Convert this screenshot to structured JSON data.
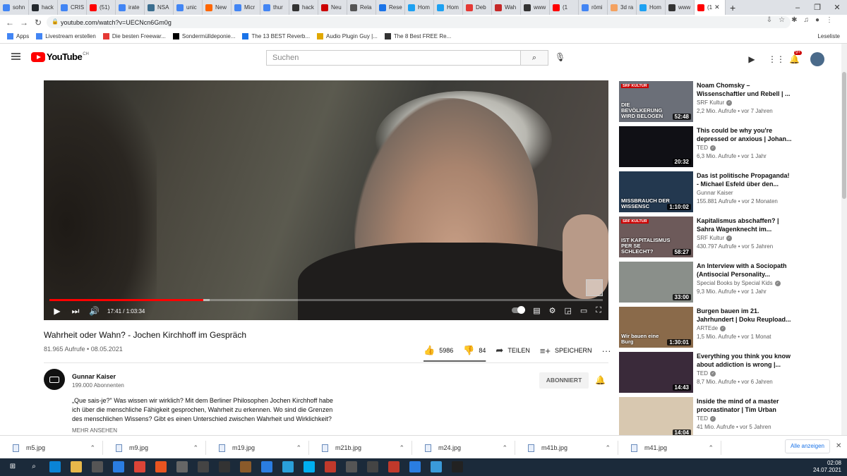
{
  "browser": {
    "tabs": [
      {
        "label": "sohn",
        "color": "#4285f4"
      },
      {
        "label": "hack",
        "color": "#24292e"
      },
      {
        "label": "CRIS",
        "color": "#4285f4"
      },
      {
        "label": "(51)",
        "color": "#ff0000"
      },
      {
        "label": "irate",
        "color": "#4285f4"
      },
      {
        "label": "NSA",
        "color": "#3b6e8f"
      },
      {
        "label": "unic",
        "color": "#4285f4"
      },
      {
        "label": "New",
        "color": "#ff6600"
      },
      {
        "label": "Micr",
        "color": "#4285f4"
      },
      {
        "label": "thur",
        "color": "#4285f4"
      },
      {
        "label": "hack",
        "color": "#333333"
      },
      {
        "label": "Neu",
        "color": "#cc0000"
      },
      {
        "label": "Rela",
        "color": "#555555"
      },
      {
        "label": "Rese",
        "color": "#1a73e8"
      },
      {
        "label": "Hom",
        "color": "#1da1f2"
      },
      {
        "label": "Hom",
        "color": "#1da1f2"
      },
      {
        "label": "Deb",
        "color": "#e53935"
      },
      {
        "label": "Wah",
        "color": "#c62828"
      },
      {
        "label": "www",
        "color": "#333333"
      },
      {
        "label": "(1",
        "color": "#ff0000"
      },
      {
        "label": "römi",
        "color": "#4285f4"
      },
      {
        "label": "3d ra",
        "color": "#f4a261"
      },
      {
        "label": "Hom",
        "color": "#1da1f2"
      },
      {
        "label": "www",
        "color": "#333333"
      },
      {
        "label": "(1",
        "color": "#ff0000"
      }
    ],
    "url": "youtube.com/watch?v=UECNcn6Gm0g",
    "bookmarks": [
      {
        "label": "Apps",
        "color": "#4285f4"
      },
      {
        "label": "Livestream erstellen",
        "color": "#4285f4"
      },
      {
        "label": "Die besten Freewar...",
        "color": "#e53935"
      },
      {
        "label": "Sondermülldeponie...",
        "color": "#000000"
      },
      {
        "label": "The 13 BEST Reverb...",
        "color": "#1a73e8"
      },
      {
        "label": "Audio Plugin Guy |...",
        "color": "#e0a800"
      },
      {
        "label": "The 8 Best FREE Re...",
        "color": "#333333"
      }
    ],
    "reading_list": "Leseliste"
  },
  "youtube": {
    "logo": "YouTube",
    "country": "CH",
    "search_placeholder": "Suchen",
    "notifications": "9+"
  },
  "player": {
    "time": "17:41 / 1:03:34",
    "progress": 0.278,
    "loaded": 0.29
  },
  "video": {
    "title": "Wahrheit oder Wahn? - Jochen Kirchhoff im Gespräch",
    "meta": "81.965 Aufrufe • 08.05.2021",
    "likes": "5986",
    "dislikes": "84",
    "like_ratio": 0.986,
    "share": "TEILEN",
    "save": "SPEICHERN"
  },
  "channel": {
    "name": "Gunnar Kaiser",
    "subscribers": "199.000 Abonnenten",
    "subscribe_label": "ABONNIERT"
  },
  "description": {
    "text": "„Que sais-je?\" Was wissen wir wirklich? Mit dem Berliner Philosophen Jochen Kirchhoff habe ich über die menschliche Fähigkeit gesprochen, Wahrheit zu erkennen. Wo sind die Grenzen des menschlichen Wissens? Gibt es einen Unterschied zwischen Wahrheit und Wirklichkeit?",
    "more": "MEHR ANSEHEN"
  },
  "related": [
    {
      "title": "Noam Chomsky – Wissenschaftler und Rebell | ...",
      "channel": "SRF Kultur",
      "verified": true,
      "meta": "2,2 Mio. Aufrufe • vor 7 Jahren",
      "duration": "52:48",
      "badge": "SRF KULTUR",
      "overlay": "DIE BEVÖLKERUNG WIRD BELOGEN",
      "bg": "#6b6f78"
    },
    {
      "title": "This could be why you're depressed or anxious | Johan...",
      "channel": "TED",
      "verified": true,
      "meta": "6,3 Mio. Aufrufe • vor 1 Jahr",
      "duration": "20:32",
      "badge": "",
      "overlay": "",
      "bg": "#101015"
    },
    {
      "title": "Das ist politische Propaganda! - Michael Esfeld über den...",
      "channel": "Gunnar Kaiser",
      "verified": false,
      "meta": "155.881 Aufrufe • vor 2 Monaten",
      "duration": "1:10:02",
      "badge": "",
      "overlay": "MISSBRAUCH DER WISSENSC",
      "bg": "#23384f"
    },
    {
      "title": "Kapitalismus abschaffen? | Sahra Wagenknecht im...",
      "channel": "SRF Kultur",
      "verified": true,
      "meta": "430.797 Aufrufe • vor 5 Jahren",
      "duration": "58:27",
      "badge": "SRF KULTUR",
      "overlay": "IST KAPITALISMUS PER SE SCHLECHT?",
      "bg": "#6d5a5a"
    },
    {
      "title": "An Interview with a Sociopath (Antisocial Personality...",
      "channel": "Special Books by Special Kids",
      "verified": true,
      "meta": "9,3 Mio. Aufrufe • vor 1 Jahr",
      "duration": "33:00",
      "badge": "",
      "overlay": "",
      "bg": "#8a8f8a"
    },
    {
      "title": "Burgen bauen im 21. Jahrhundert | Doku Reupload...",
      "channel": "ARTEde",
      "verified": true,
      "meta": "1,5 Mio. Aufrufe • vor 1 Monat",
      "duration": "1:30:01",
      "badge": "",
      "overlay": "Wir bauen eine Burg",
      "bg": "#8a6a4a"
    },
    {
      "title": "Everything you think you know about addiction is wrong |...",
      "channel": "TED",
      "verified": true,
      "meta": "8,7 Mio. Aufrufe • vor 6 Jahren",
      "duration": "14:43",
      "badge": "",
      "overlay": "",
      "bg": "#3a2a3a"
    },
    {
      "title": "Inside the mind of a master procrastinator | Tim Urban",
      "channel": "TED",
      "verified": true,
      "meta": "41 Mio. Aufrufe • vor 5 Jahren",
      "duration": "14:04",
      "badge": "",
      "overlay": "",
      "bg": "#d8c8b0"
    }
  ],
  "downloads": {
    "items": [
      "m5.jpg",
      "m9.jpg",
      "m19.jpg",
      "m21b.jpg",
      "m24.jpg",
      "m41b.jpg",
      "m41.jpg"
    ],
    "show_all": "Alle anzeigen"
  },
  "taskbar": {
    "time": "02:08",
    "date": "24.07.2021"
  }
}
